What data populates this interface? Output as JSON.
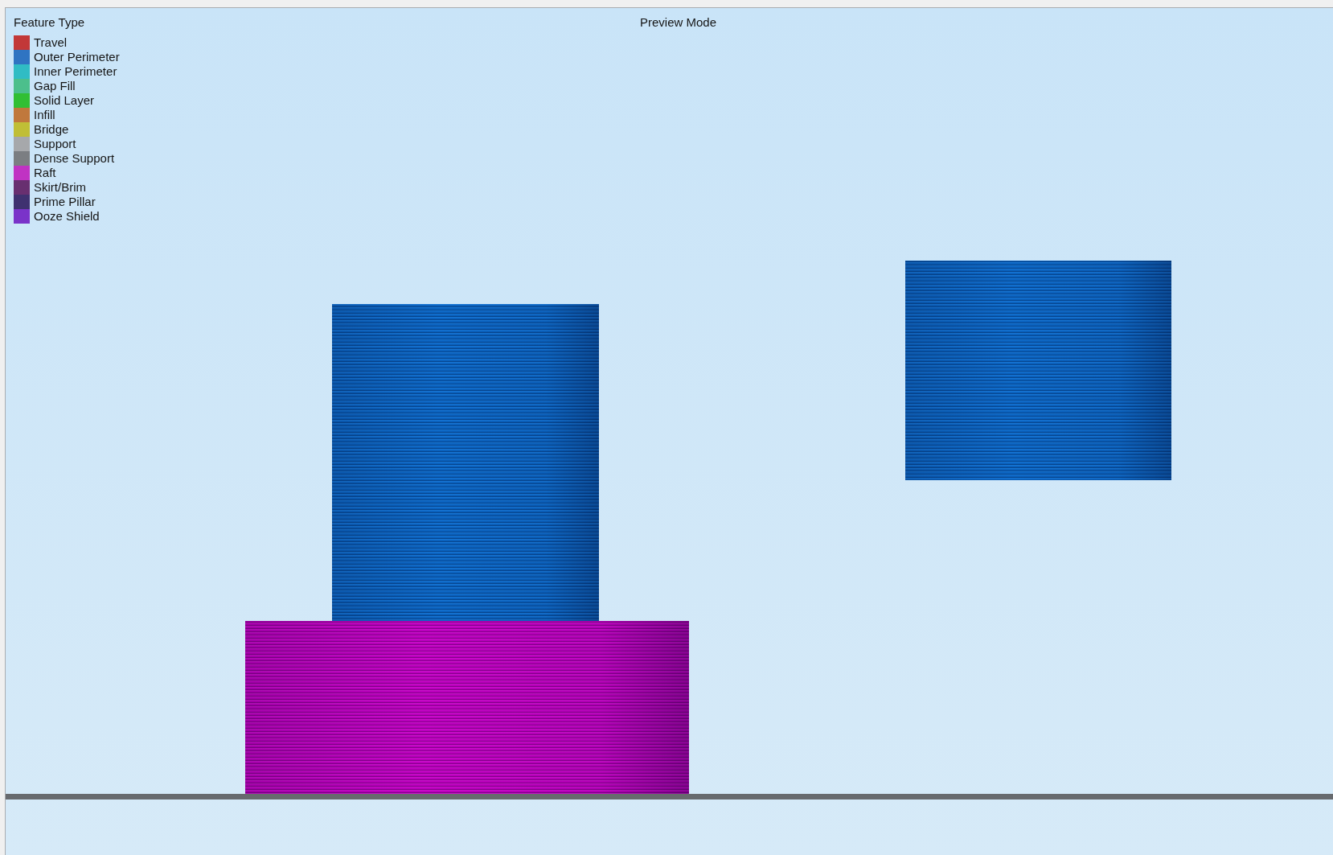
{
  "viewport": {
    "mode_label": "Preview Mode"
  },
  "legend": {
    "title": "Feature Type",
    "items": [
      {
        "label": "Travel",
        "color": "#c23838"
      },
      {
        "label": "Outer Perimeter",
        "color": "#2f74c2"
      },
      {
        "label": "Inner Perimeter",
        "color": "#30bcc4"
      },
      {
        "label": "Gap Fill",
        "color": "#4cbf8c"
      },
      {
        "label": "Solid Layer",
        "color": "#31bf33"
      },
      {
        "label": "Infill",
        "color": "#c0783c"
      },
      {
        "label": "Bridge",
        "color": "#c0be36"
      },
      {
        "label": "Support",
        "color": "#a6a8ab"
      },
      {
        "label": "Dense Support",
        "color": "#7b7e82"
      },
      {
        "label": "Raft",
        "color": "#c033c3"
      },
      {
        "label": "Skirt/Brim",
        "color": "#682f70"
      },
      {
        "label": "Prime Pillar",
        "color": "#3f3170"
      },
      {
        "label": "Ooze Shield",
        "color": "#7a33c9"
      }
    ]
  }
}
